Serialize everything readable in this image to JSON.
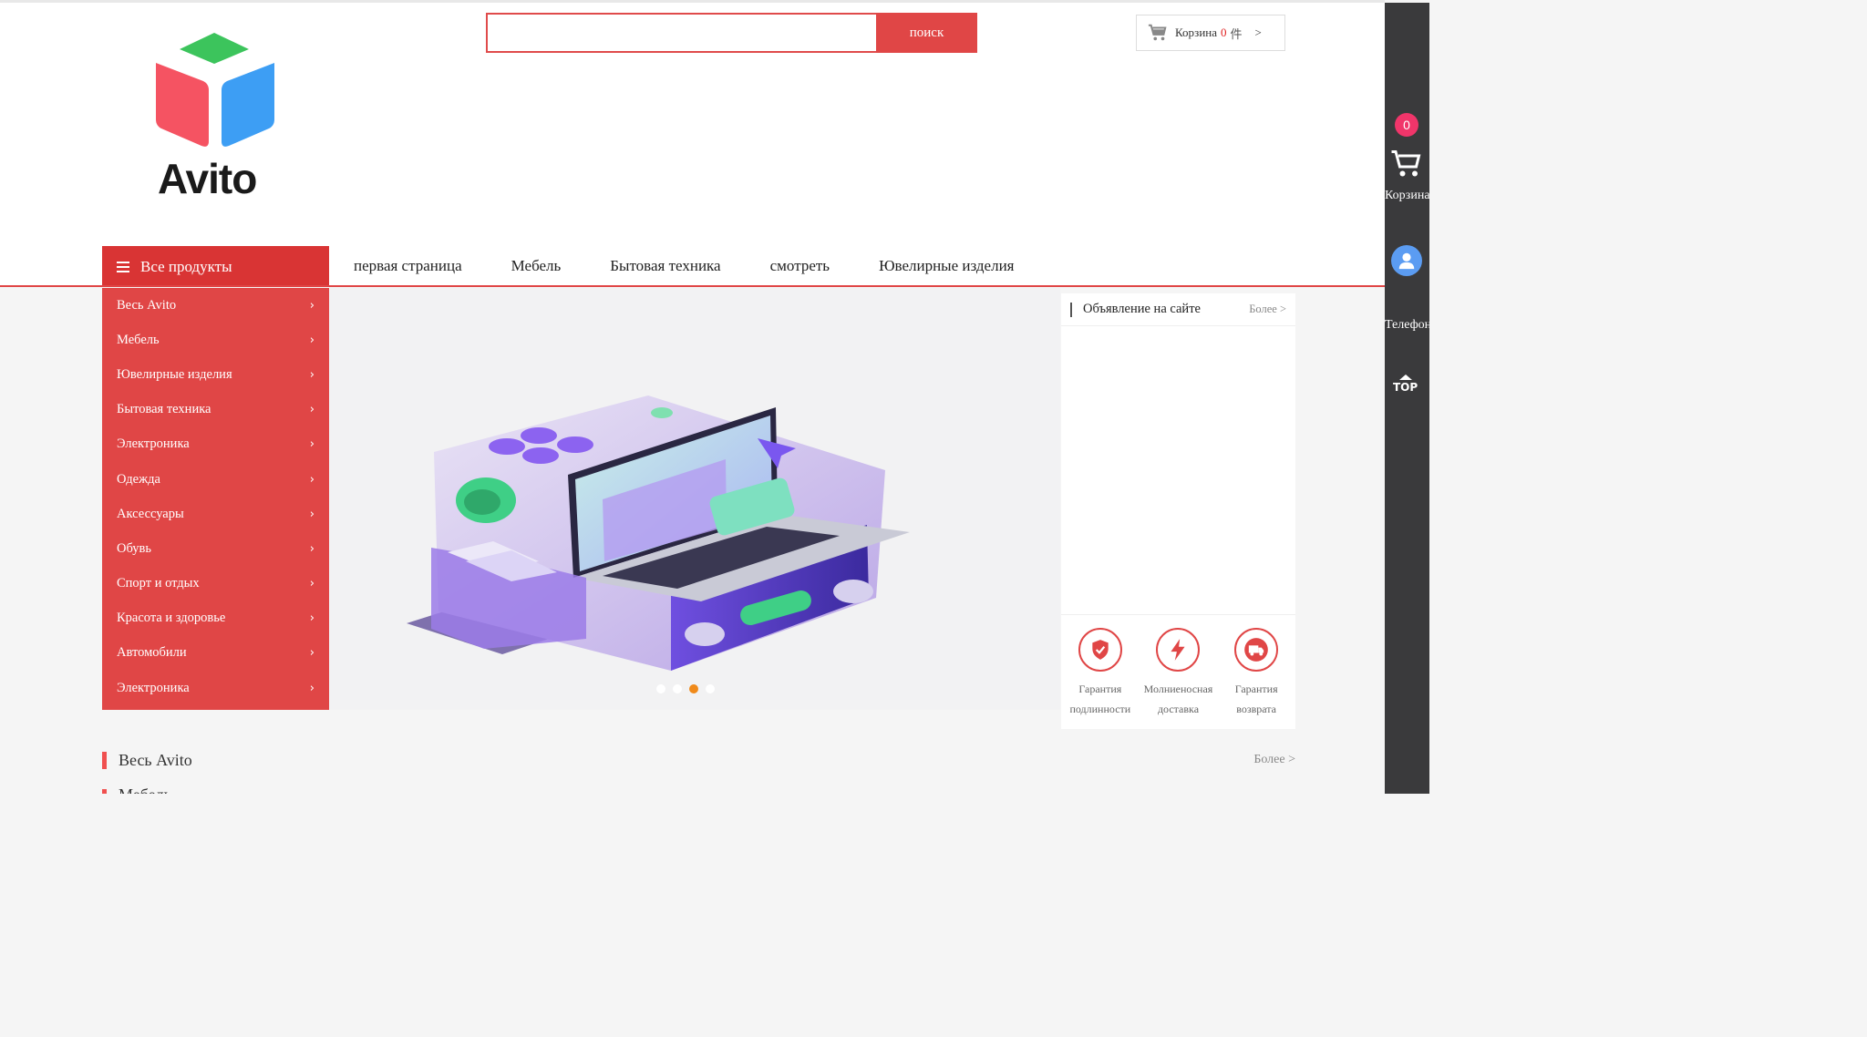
{
  "logo": {
    "text": "Avito"
  },
  "search": {
    "placeholder": "",
    "value": "",
    "button_label": "поиск"
  },
  "cart": {
    "label": "Корзина",
    "count": "0",
    "unit": "件",
    "arrow": ">"
  },
  "nav": {
    "all_products": "Все продукты",
    "links": [
      "первая страница",
      "Мебель",
      "Бытовая техника",
      "смотреть",
      "Ювелирные изделия"
    ]
  },
  "categories": [
    "Весь Avito",
    "Мебель",
    "Ювелирные изделия",
    "Бытовая техника",
    "Электроника",
    "Одежда",
    "Аксессуары",
    "Обувь",
    "Спорт и отдых",
    "Красота и здоровье",
    "Автомобили",
    "Электроника"
  ],
  "carousel": {
    "slides": 4,
    "active_index": 2
  },
  "notice": {
    "title": "Объявление на сайте",
    "more": "Более >",
    "guarantees": [
      {
        "icon": "shield-check-icon",
        "line1": "Гарантия",
        "line2": "подлинности"
      },
      {
        "icon": "lightning-icon",
        "line1": "Молниеносная",
        "line2": "доставка"
      },
      {
        "icon": "delivery-truck-icon",
        "line1": "Гарантия",
        "line2": "возврата"
      }
    ]
  },
  "section": {
    "title": "Весь Avito",
    "more": "Более >",
    "next_title": "Мебель"
  },
  "rail": {
    "cart_count": "0",
    "cart_label": "Корзина",
    "phone_label": "Телефон",
    "top_label": "TOP"
  },
  "colors": {
    "accent": "#e04646",
    "menu_bg": "#e04646",
    "rail_bg": "#3a3a3c",
    "active_dot": "#f08a1a",
    "badge": "#f0356a",
    "user_icon": "#5b9cf2"
  }
}
